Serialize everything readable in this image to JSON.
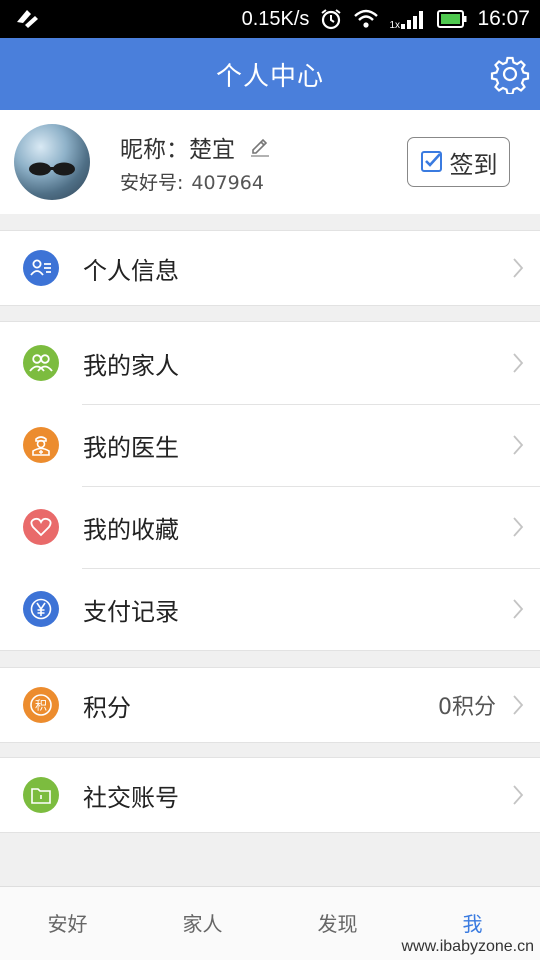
{
  "status_bar": {
    "speed": "0.15K/s",
    "network": "1x",
    "time": "16:07"
  },
  "header": {
    "title": "个人中心",
    "settings_icon": "gear-icon"
  },
  "profile": {
    "nickname_label": "昵称：",
    "nickname": "楚宜",
    "id_label": "安好号:",
    "id_value": "407964",
    "signin_label": "签到"
  },
  "menu": {
    "personal_info": {
      "label": "个人信息",
      "icon": "contact-card-icon",
      "color": "#3d73d6"
    },
    "family": {
      "label": "我的家人",
      "icon": "people-icon",
      "color": "#7cbc3f"
    },
    "doctor": {
      "label": "我的医生",
      "icon": "doctor-icon",
      "color": "#ec8c2e"
    },
    "favorites": {
      "label": "我的收藏",
      "icon": "heart-icon",
      "color": "#e96a6a"
    },
    "payments": {
      "label": "支付记录",
      "icon": "yen-icon",
      "color": "#3d73d6"
    },
    "points": {
      "label": "积分",
      "value": "0积分",
      "icon": "points-icon",
      "glyph": "积",
      "color": "#ec8c2e"
    },
    "social": {
      "label": "社交账号",
      "icon": "folder-icon",
      "color": "#7cbc3f"
    }
  },
  "tabs": [
    {
      "label": "安好"
    },
    {
      "label": "家人"
    },
    {
      "label": "发现"
    },
    {
      "label": "我"
    }
  ],
  "watermark": "www.ibabyzone.cn",
  "colors": {
    "accent": "#4a7fdb",
    "active_tab": "#3a7be0"
  }
}
